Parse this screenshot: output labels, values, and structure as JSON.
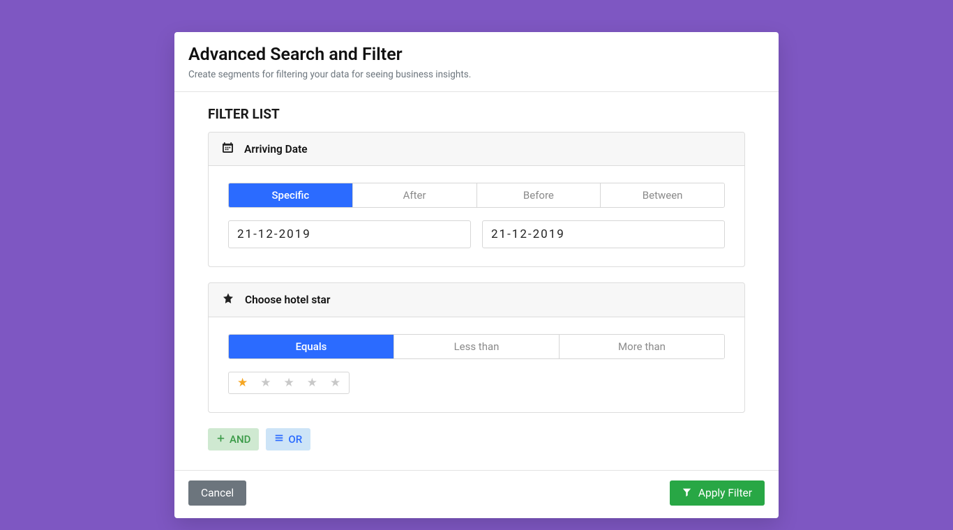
{
  "header": {
    "title": "Advanced Search and Filter",
    "subtitle": "Create segments for filtering your data for seeing business insights."
  },
  "filter_list_title": "Filter List",
  "filters": {
    "arriving_date": {
      "title": "Arriving Date",
      "tabs": [
        "Specific",
        "After",
        "Before",
        "Between"
      ],
      "active_tab": 0,
      "date_from": "21-12-2019",
      "date_to": "21-12-2019"
    },
    "hotel_star": {
      "title": "Choose hotel star",
      "tabs": [
        "Equals",
        "Less than",
        "More than"
      ],
      "active_tab": 0,
      "rating": 1,
      "max_rating": 5
    }
  },
  "logic": {
    "and_label": "AND",
    "or_label": "OR"
  },
  "footer": {
    "cancel": "Cancel",
    "apply": "Apply Filter"
  }
}
